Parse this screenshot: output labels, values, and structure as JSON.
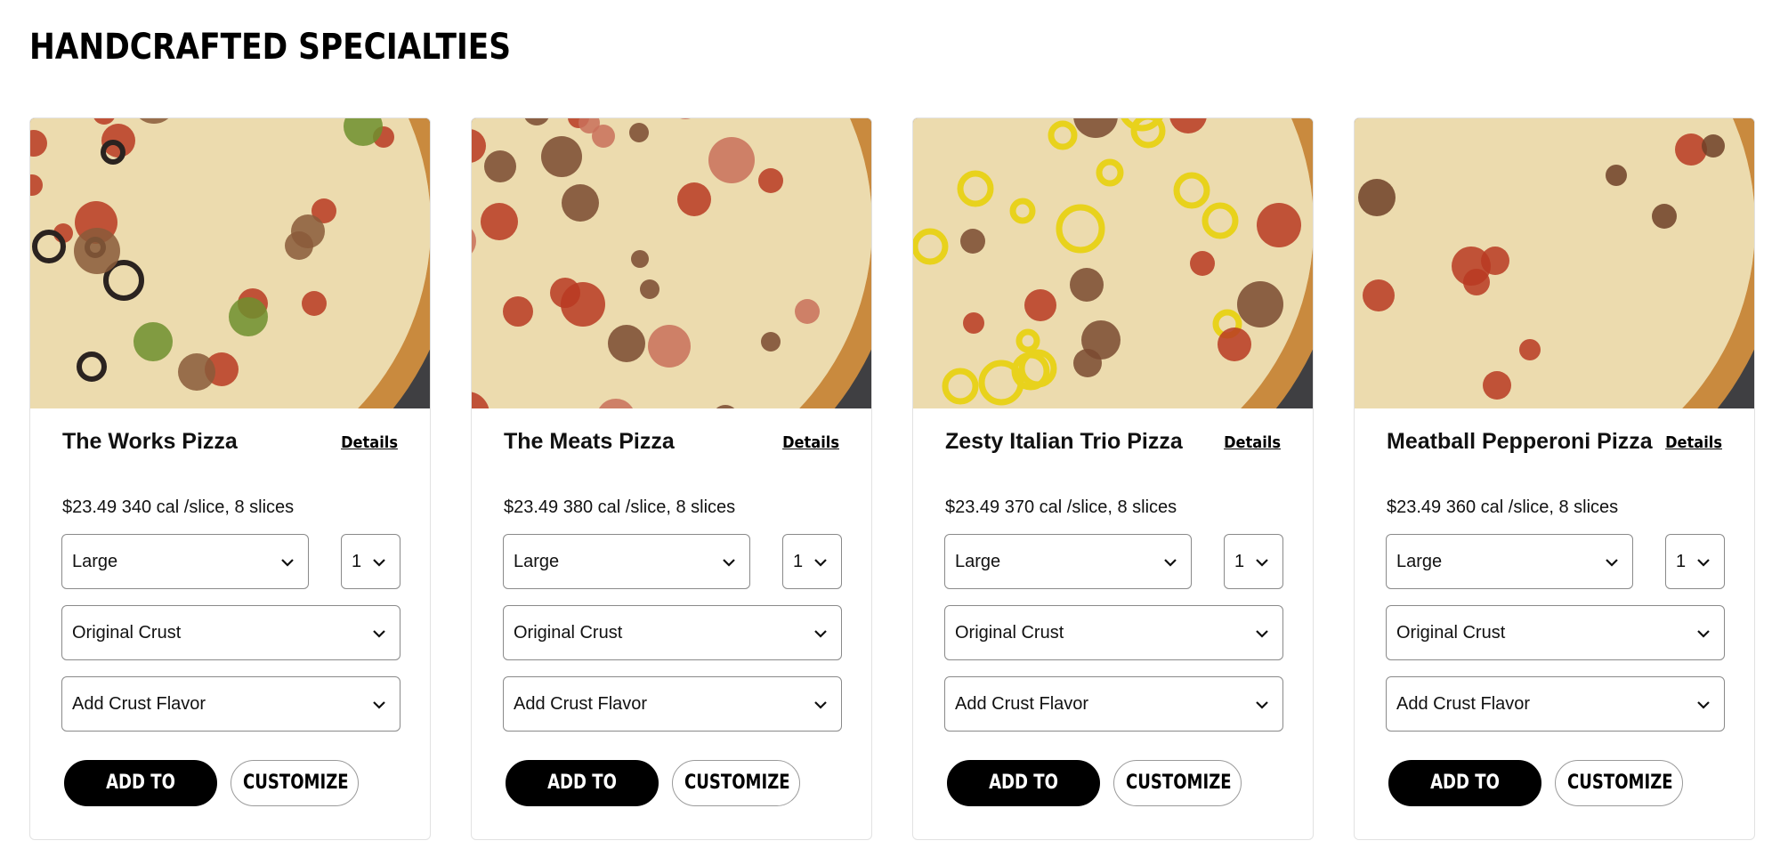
{
  "section": {
    "title": "HANDCRAFTED SPECIALTIES"
  },
  "common": {
    "details_label": "Details",
    "add_label": "ADD TO ORDER",
    "customize_label": "CUSTOMIZE",
    "size_value": "Large",
    "qty_value": "1",
    "crust_value": "Original Crust",
    "flavor_value": "Add Crust Flavor"
  },
  "cards": [
    {
      "name": "The Works Pizza",
      "price": "$23.49",
      "nutrition": "340 cal /slice, 8 slices",
      "image": "the-works-pizza-photo"
    },
    {
      "name": "The Meats Pizza",
      "price": "$23.49",
      "nutrition": "380 cal /slice, 8 slices",
      "image": "the-meats-pizza-photo"
    },
    {
      "name": "Zesty Italian Trio Pizza",
      "price": "$23.49",
      "nutrition": "370 cal /slice, 8 slices",
      "image": "zesty-italian-trio-pizza-photo"
    },
    {
      "name": "Meatball Pepperoni Pizza",
      "price": "$23.49",
      "nutrition": "360 cal /slice, 8 slices",
      "image": "meatball-pepperoni-pizza-photo"
    }
  ],
  "colors": {
    "button_primary": "#000000",
    "card_border": "#e2e2e2",
    "field_border": "#8a8a8a"
  }
}
